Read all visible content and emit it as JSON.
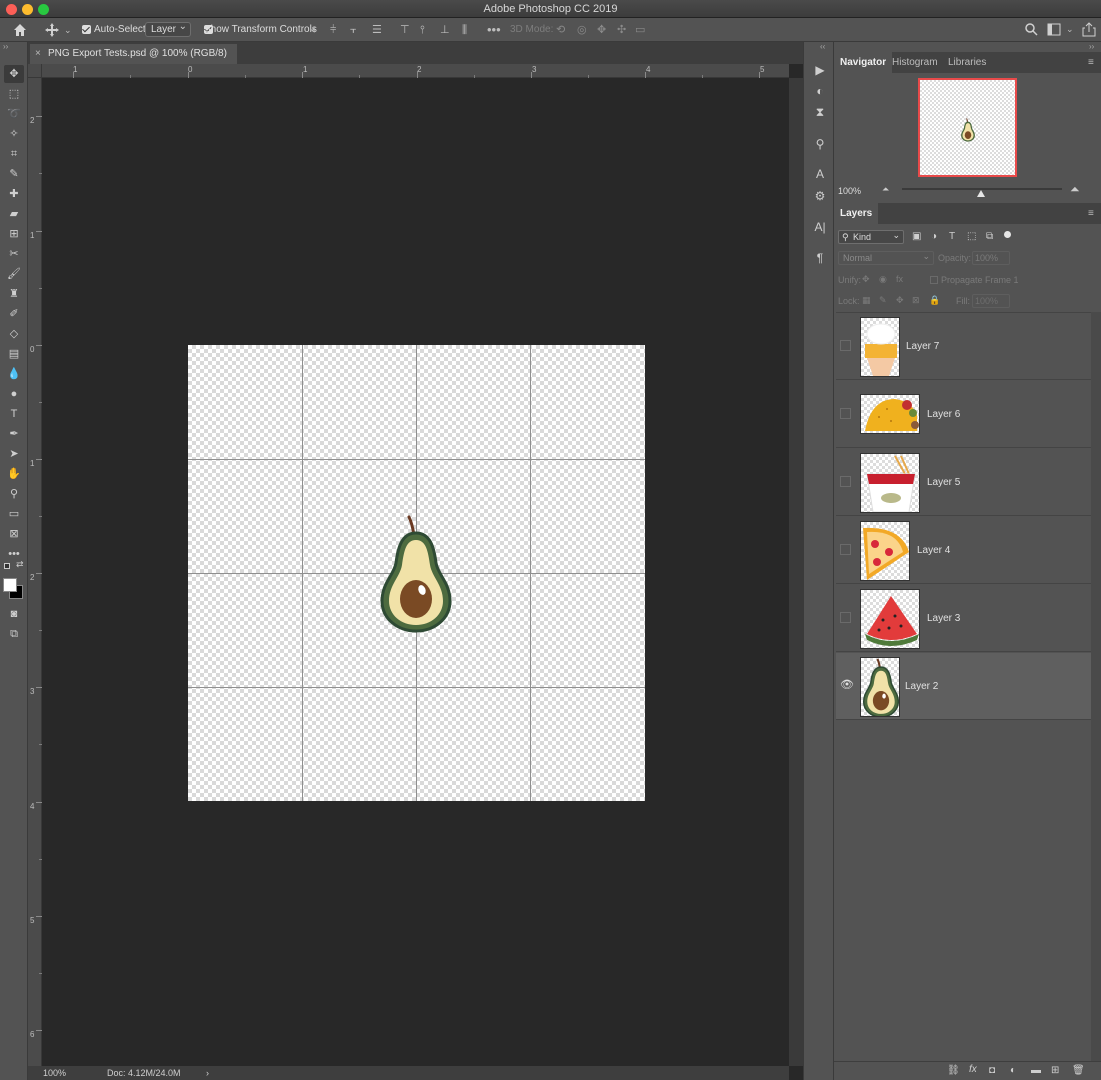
{
  "window": {
    "title": "Adobe Photoshop CC 2019",
    "traffic_colors": [
      "#fc5f57",
      "#fdbc2e",
      "#28c840"
    ]
  },
  "options": {
    "auto_select_label": "Auto-Select:",
    "auto_select_value": "Layer",
    "transform_label": "Show Transform Controls",
    "mode_3d_label": "3D Mode:"
  },
  "document": {
    "tab_title": "PNG Export Tests.psd @ 100% (RGB/8)"
  },
  "status": {
    "zoom": "100%",
    "doc_size": "Doc: 4.12M/24.0M"
  },
  "rulers": {
    "horizontal": [
      "0",
      "1",
      "1",
      "2",
      "3",
      "4",
      "5"
    ],
    "vertical": [
      "2",
      "1",
      "0",
      "1",
      "2",
      "3",
      "4",
      "5",
      "6"
    ]
  },
  "navigator": {
    "tabs": [
      "Navigator",
      "Histogram",
      "Libraries"
    ],
    "zoom": "100%"
  },
  "layers_panel": {
    "tab": "Layers",
    "kind_label": "Kind",
    "blend_mode": "Normal",
    "opacity_label": "Opacity:",
    "opacity_value": "100%",
    "unify_label": "Unify:",
    "propagate_label": "Propagate Frame 1",
    "lock_label": "Lock:",
    "fill_label": "Fill:",
    "fill_value": "100%",
    "layers": [
      {
        "name": "Layer 7",
        "visible": false
      },
      {
        "name": "Layer 6",
        "visible": false
      },
      {
        "name": "Layer 5",
        "visible": false
      },
      {
        "name": "Layer 4",
        "visible": false
      },
      {
        "name": "Layer 3",
        "visible": false
      },
      {
        "name": "Layer 2",
        "visible": true
      }
    ]
  },
  "colors": {
    "accent": "#e84a4a",
    "panel_bg": "#535353",
    "app_bg": "#282828"
  }
}
